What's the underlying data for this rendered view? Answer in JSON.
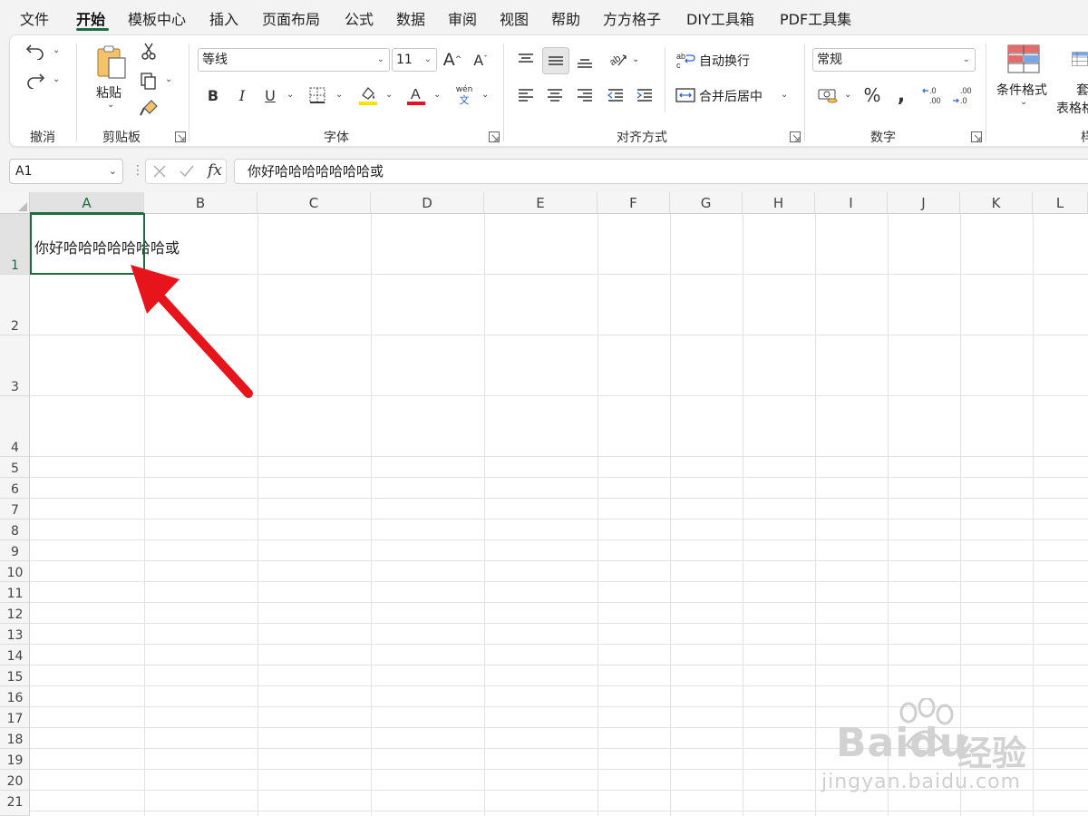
{
  "menu": {
    "tabs": [
      "文件",
      "开始",
      "模板中心",
      "插入",
      "页面布局",
      "公式",
      "数据",
      "审阅",
      "视图",
      "帮助",
      "方方格子",
      "DIY工具箱",
      "PDF工具集"
    ],
    "active_tab": "开始"
  },
  "ribbon": {
    "groups": {
      "undo": "撤消",
      "clipboard": "剪贴板",
      "font": "字体",
      "alignment": "对齐方式",
      "number": "数字"
    },
    "paste_label": "粘贴",
    "font_name": "等线",
    "font_size": "11",
    "wrap_text_label": "自动换行",
    "merge_center_label": "合并后居中",
    "number_format": "常规",
    "conditional_format_label": "条件格式",
    "table_format_label_top": "套",
    "table_format_label_bottom": "表格格",
    "styles_group_partial": "样",
    "font_color": "#e81123",
    "fill_color": "#ffe100",
    "phonetic_top": "wén",
    "phonetic_bottom": "文"
  },
  "formula_bar": {
    "name_box": "A1",
    "fx_label": "fx",
    "content": "你好哈哈哈哈哈哈哈或"
  },
  "sheet": {
    "columns": [
      "A",
      "B",
      "C",
      "D",
      "E",
      "F",
      "G",
      "H",
      "I",
      "J",
      "K",
      "L"
    ],
    "rows": [
      "1",
      "2",
      "3",
      "4",
      "5",
      "6",
      "7",
      "8",
      "9",
      "10",
      "11",
      "12",
      "13",
      "14",
      "15",
      "16",
      "17",
      "18",
      "19",
      "20",
      "21"
    ],
    "selected_cell": "A1",
    "cell_a1": "你好哈哈哈哈哈哈哈或"
  },
  "annotation": {
    "arrow_color": "#e8141c"
  },
  "watermark": {
    "brand": "Baidu",
    "brand_cn": "经验",
    "url": "jingyan.baidu.com"
  },
  "colors": {
    "accent": "#1e6b41"
  }
}
